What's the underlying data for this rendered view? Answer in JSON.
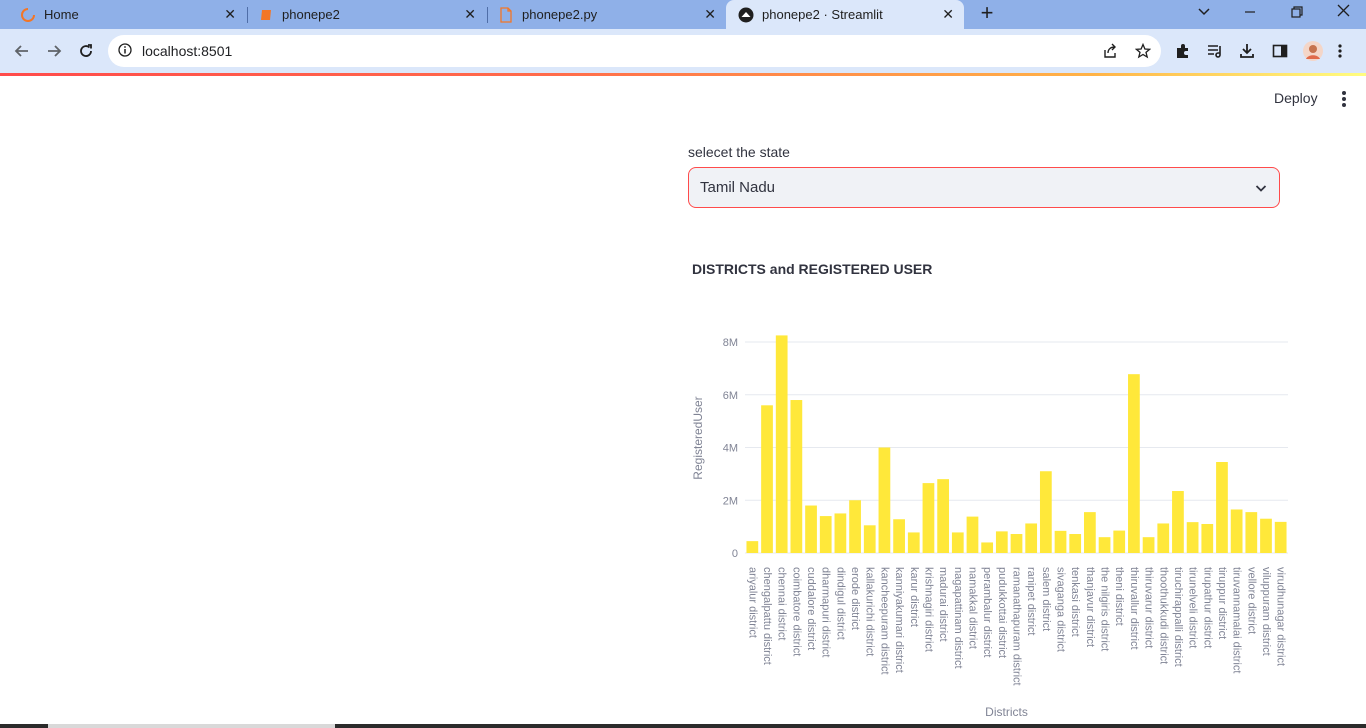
{
  "browser": {
    "tabs": [
      {
        "title": "Home",
        "icon": "streamlit-loading-icon"
      },
      {
        "title": "phonepe2",
        "icon": "notebook-icon"
      },
      {
        "title": "phonepe2.py",
        "icon": "file-icon"
      },
      {
        "title": "phonepe2 · Streamlit",
        "icon": "streamlit-icon",
        "active": true
      }
    ],
    "url": "localhost:8501"
  },
  "app": {
    "deploy_label": "Deploy",
    "select": {
      "label": "selecet the state",
      "value": "Tamil Nadu"
    },
    "chart_title": "DISTRICTS and REGISTERED USER"
  },
  "colors": {
    "accent": "#ff4b4b",
    "bar": "#ffe83a",
    "tabstrip": "#8fb0e8",
    "toolbar": "#dbe7fa"
  },
  "chart_data": {
    "type": "bar",
    "title": "DISTRICTS and REGISTERED USER",
    "xlabel": "Districts",
    "ylabel": "RegisteredUser",
    "ylim": [
      0,
      8000000
    ],
    "yticks": [
      0,
      2000000,
      4000000,
      6000000,
      8000000
    ],
    "ytick_labels": [
      "0",
      "2M",
      "4M",
      "6M",
      "8M"
    ],
    "grid": true,
    "categories": [
      "ariyalur district",
      "chengalpattu district",
      "chennai district",
      "coimbatore district",
      "cuddalore district",
      "dharmapuri district",
      "dindigul district",
      "erode district",
      "kallakurichi district",
      "kancheepuram district",
      "kanniyakumari district",
      "karur district",
      "krishnagiri district",
      "madurai district",
      "nagapattinam district",
      "namakkal district",
      "perambalur district",
      "pudukkottai district",
      "ramanathapuram district",
      "ranipet district",
      "salem district",
      "sivaganga district",
      "tenkasi district",
      "thanjavur district",
      "the nilgiris district",
      "theni district",
      "thiruvallur district",
      "thiruvarur district",
      "thoothukkudi district",
      "tiruchirappalli district",
      "tirunelveli district",
      "tirupathur district",
      "tiruppur district",
      "tiruvannamalai district",
      "vellore district",
      "viluppuram district",
      "virudhunagar district"
    ],
    "values": [
      450000,
      5600000,
      8250000,
      5800000,
      1800000,
      1400000,
      1500000,
      2000000,
      1050000,
      4000000,
      1280000,
      780000,
      2650000,
      2800000,
      780000,
      1380000,
      400000,
      820000,
      720000,
      1120000,
      3100000,
      840000,
      720000,
      1550000,
      600000,
      850000,
      6780000,
      600000,
      1120000,
      2350000,
      1170000,
      1100000,
      3450000,
      1650000,
      1550000,
      1300000,
      1180000
    ]
  }
}
